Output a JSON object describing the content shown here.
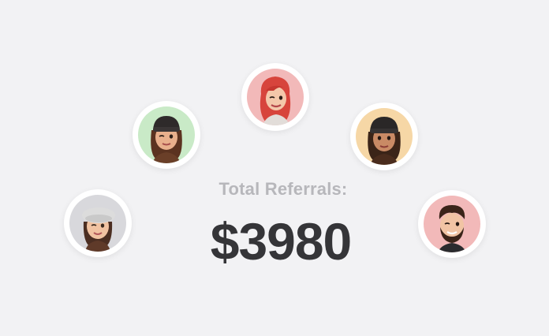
{
  "referrals": {
    "label": "Total Referrals:",
    "amount": "$3980"
  },
  "avatars": [
    {
      "id": "avatar-1",
      "bg": "#d8d8dc",
      "icon": "memoji-woman-beret-icon"
    },
    {
      "id": "avatar-2",
      "bg": "#c9eac7",
      "icon": "memoji-woman-beanie-wink-icon"
    },
    {
      "id": "avatar-3",
      "bg": "#f2b9b9",
      "icon": "memoji-woman-red-hair-icon"
    },
    {
      "id": "avatar-4",
      "bg": "#f6d7a6",
      "icon": "memoji-woman-beanie-icon"
    },
    {
      "id": "avatar-5",
      "bg": "#f2b9b9",
      "icon": "memoji-man-beard-icon"
    }
  ]
}
